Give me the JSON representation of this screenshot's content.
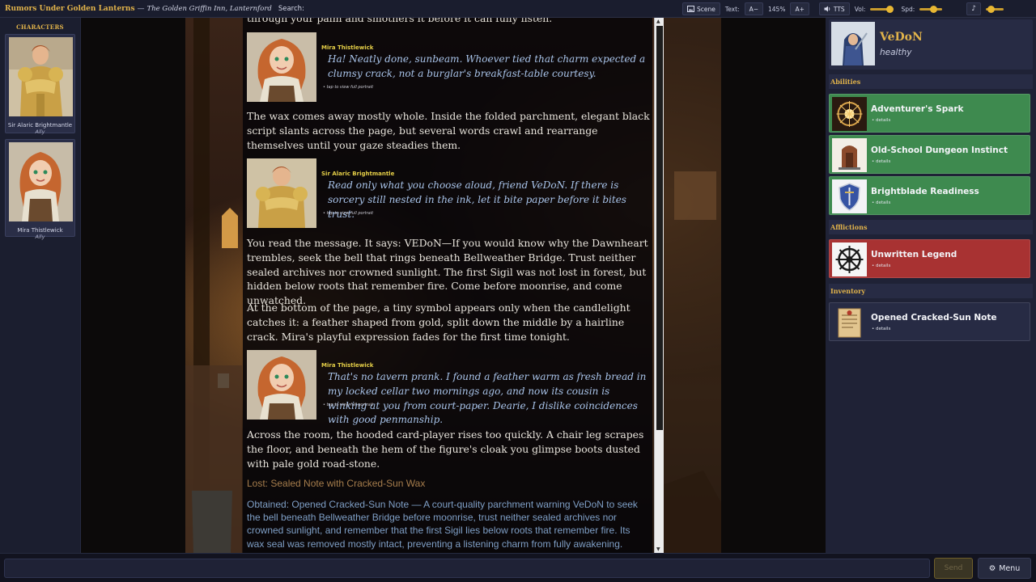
{
  "topbar": {
    "title": "Rumors Under Golden Lanterns",
    "separator": "—",
    "location": "The Golden Griffin Inn, Lanternford",
    "search_label": "Search:",
    "scene_button": "Scene",
    "text_label": "Text:",
    "text_decrease": "A−",
    "zoom": "145%",
    "text_increase": "A+",
    "tts_button": "TTS",
    "vol_label": "Vol:",
    "vol_level": 0.85,
    "spd_label": "Spd:",
    "spd_level": 0.6,
    "music_level": 0.25
  },
  "characters": {
    "heading": "CHARACTERS",
    "items": [
      {
        "name": "Sir Alaric Brightmantle",
        "role": "Ally",
        "icon": "armored-knight-portrait"
      },
      {
        "name": "Mira Thistlewick",
        "role": "Ally",
        "icon": "elf-woman-portrait"
      }
    ]
  },
  "story": {
    "partial_top": "through your palm and smothers it before it can fully listen.",
    "dialogue1": {
      "name": "Mira Thistlewick",
      "text": "Ha! Neatly done, sunbeam. Whoever tied that charm expected a clumsy crack, not a burglar's breakfast-table courtesy.",
      "hint": "• tap to view full portrait"
    },
    "para1": "The wax comes away mostly whole. Inside the folded parchment, elegant black script slants across the page, but several words crawl and rearrange themselves until your gaze steadies them.",
    "dialogue2": {
      "name": "Sir Alaric Brightmantle",
      "text": "Read only what you choose aloud, friend VeDoN. If there is sorcery still nested in the ink, let it bite paper before it bites trust.",
      "hint": "• tap to view full portrait"
    },
    "para2": "You read the message. It says: VEDoN—If you would know why the Dawnheart trembles, seek the bell that rings beneath Bellweather Bridge. Trust neither sealed archives nor crowned sunlight. The first Sigil was not lost in forest, but hidden below roots that remember fire. Come before moonrise, and come unwatched.",
    "para3": "At the bottom of the page, a tiny symbol appears only when the candlelight catches it: a feather shaped from gold, split down the middle by a hairline crack. Mira's playful expression fades for the first time tonight.",
    "dialogue3": {
      "name": "Mira Thistlewick",
      "text": "That's no tavern prank. I found a feather warm as fresh bread in my locked cellar two mornings ago, and now its cousin is winking at you from court-paper. Dearie, I dislike coincidences with good penmanship.",
      "hint": "• tap to view full portrait"
    },
    "para4": "Across the room, the hooded card-player rises too quickly. A chair leg scrapes the floor, and beneath the hem of the figure's cloak you glimpse boots dusted with pale gold road-stone.",
    "lost": "Lost: Sealed Note with Cracked-Sun Wax",
    "obtained": "Obtained: Opened Cracked-Sun Note — A court-quality parchment warning VeDoN to seek the bell beneath Bellweather Bridge before moonrise, trust neither sealed archives nor crowned sunlight, and remember that the first Sigil lies below roots that remember fire. Its wax seal was removed mostly intact, preventing a listening charm from fully awakening."
  },
  "player": {
    "name": "VeDoN",
    "status": "healthy",
    "icon": "hooded-adventurer-portrait"
  },
  "abilities": {
    "heading": "Abilities",
    "items": [
      {
        "name": "Adventurer's Spark",
        "details": "• details",
        "icon": "spark-icon"
      },
      {
        "name": "Old-School Dungeon Instinct",
        "details": "• details",
        "icon": "dungeon-door-icon"
      },
      {
        "name": "Brightblade Readiness",
        "details": "• details",
        "icon": "shield-icon"
      }
    ]
  },
  "afflictions": {
    "heading": "Afflictions",
    "items": [
      {
        "name": "Unwritten Legend",
        "details": "• details",
        "icon": "compass-wheel-icon"
      }
    ]
  },
  "inventory": {
    "heading": "Inventory",
    "items": [
      {
        "name": "Opened Cracked-Sun Note",
        "details": "• details",
        "icon": "parchment-icon"
      }
    ]
  },
  "bottombar": {
    "input_placeholder": "",
    "send_label": "Send",
    "menu_label": "Menu"
  },
  "colors": {
    "accent_gold": "#e0b24a",
    "ability_green": "#3e8a4f",
    "affliction_red": "#a83232",
    "dialogue_blue": "#a9c4ea",
    "obtained_blue": "#7f9fc6",
    "lost_brown": "#a67d4c"
  }
}
